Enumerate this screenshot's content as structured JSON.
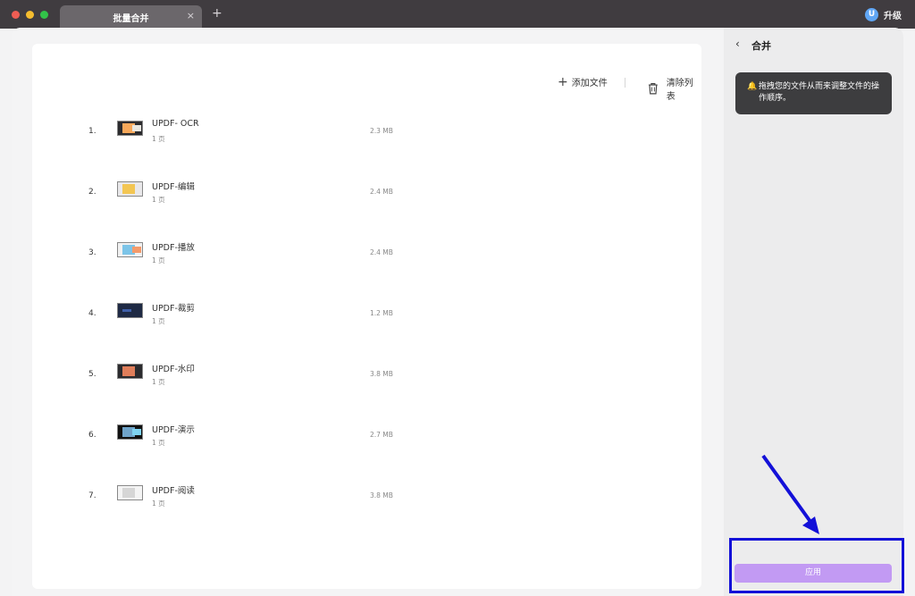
{
  "tab": {
    "title": "批量合并",
    "close": "×",
    "add": "+"
  },
  "upgrade": {
    "logo": "U",
    "label": "升级"
  },
  "toolbar": {
    "add_label": "添加文件",
    "clear_label": "清除列表"
  },
  "files": [
    {
      "index": "1.",
      "name": "UPDF- OCR",
      "pages": "1 页",
      "size": "2.3 MB"
    },
    {
      "index": "2.",
      "name": "UPDF-编辑",
      "pages": "1 页",
      "size": "2.4 MB"
    },
    {
      "index": "3.",
      "name": "UPDF-播放",
      "pages": "1 页",
      "size": "2.4 MB"
    },
    {
      "index": "4.",
      "name": "UPDF-裁剪",
      "pages": "1 页",
      "size": "1.2 MB"
    },
    {
      "index": "5.",
      "name": "UPDF-水印",
      "pages": "1 页",
      "size": "3.8 MB"
    },
    {
      "index": "6.",
      "name": "UPDF-演示",
      "pages": "1 页",
      "size": "2.7 MB"
    },
    {
      "index": "7.",
      "name": "UPDF-阅读",
      "pages": "1 页",
      "size": "3.8 MB"
    }
  ],
  "sidebar": {
    "back": "‹",
    "title": "合并",
    "tip_icon": "🔔",
    "tip": "拖拽您的文件从而来调整文件的操作顺序。",
    "apply_label": "应用"
  },
  "colors": {
    "accent": "#c29af3",
    "annotation": "#1310d8"
  }
}
